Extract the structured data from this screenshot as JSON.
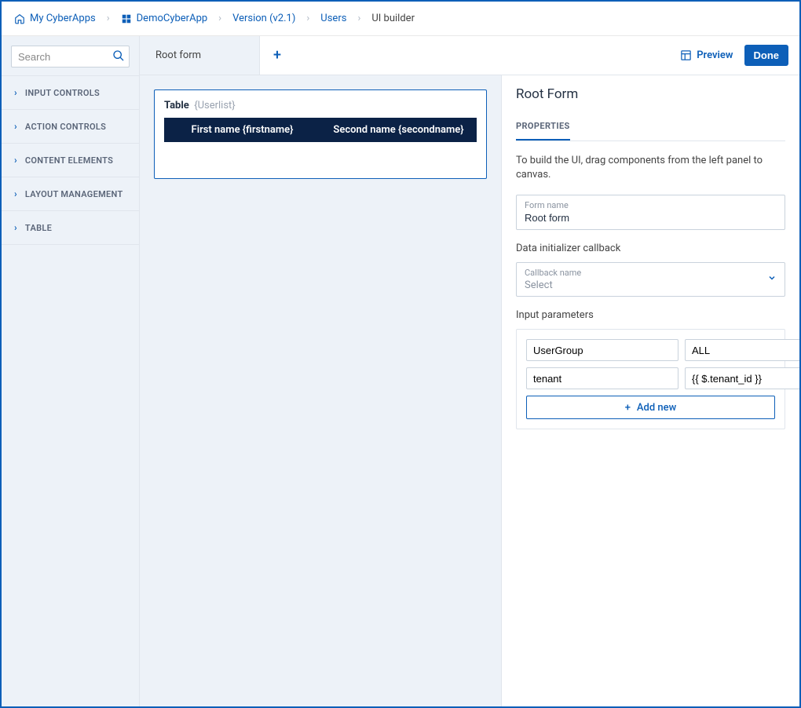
{
  "breadcrumb": [
    {
      "label": "My CyberApps",
      "icon": "home"
    },
    {
      "label": "DemoCyberApp",
      "icon": "app"
    },
    {
      "label": "Version (v2.1)"
    },
    {
      "label": "Users"
    },
    {
      "label": "UI builder",
      "current": true
    }
  ],
  "sidebar": {
    "search_placeholder": "Search",
    "categories": [
      "INPUT CONTROLS",
      "ACTION CONTROLS",
      "CONTENT ELEMENTS",
      "LAYOUT MANAGEMENT",
      "TABLE"
    ]
  },
  "tabs": {
    "active": "Root form"
  },
  "topbar": {
    "preview": "Preview",
    "done": "Done"
  },
  "canvas": {
    "card_label": "Table",
    "card_binding": "{Userlist}",
    "columns": [
      "First name {firstname}",
      "Second name {secondname}"
    ]
  },
  "panel": {
    "title": "Root Form",
    "tab": "PROPERTIES",
    "hint": "To build the UI, drag components from the left panel to canvas.",
    "form_name_label": "Form name",
    "form_name_value": "Root form",
    "callback_section": "Data initializer callback",
    "callback_label": "Callback name",
    "callback_value": "Select",
    "params_section": "Input parameters",
    "params": [
      {
        "key": "UserGroup",
        "value": "ALL"
      },
      {
        "key": "tenant",
        "value": "{{ $.tenant_id }}"
      }
    ],
    "add_new": "Add new"
  }
}
